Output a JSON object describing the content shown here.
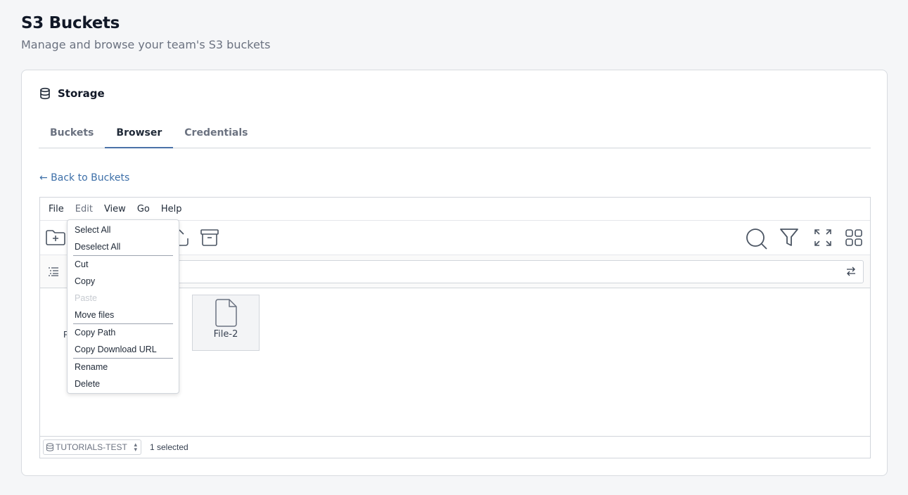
{
  "header": {
    "title": "S3 Buckets",
    "subtitle": "Manage and browse your team's S3 buckets"
  },
  "card": {
    "title": "Storage",
    "icon": "database-icon"
  },
  "tabs": [
    {
      "label": "Buckets",
      "active": false
    },
    {
      "label": "Browser",
      "active": true
    },
    {
      "label": "Credentials",
      "active": false
    }
  ],
  "back_link": "← Back to Buckets",
  "menubar": {
    "file": "File",
    "edit": "Edit",
    "view": "View",
    "go": "Go",
    "help": "Help"
  },
  "toolbar": {
    "icons": [
      "new-folder-icon",
      "upload-icon",
      "archive-icon",
      "search-icon",
      "filter-icon",
      "fullscreen-icon",
      "grid-view-icon"
    ]
  },
  "files": [
    {
      "name": "File-2",
      "icon": "file-icon"
    }
  ],
  "partial_file_label": "F",
  "edit_menu": {
    "select_all": "Select All",
    "deselect_all": "Deselect All",
    "cut": "Cut",
    "copy": "Copy",
    "paste": "Paste",
    "move_files": "Move files",
    "copy_path": "Copy Path",
    "copy_download_url": "Copy Download URL",
    "rename": "Rename",
    "delete": "Delete"
  },
  "statusbar": {
    "bucket": "TUTORIALS-TEST",
    "selected": "1 selected"
  },
  "colors": {
    "accent": "#4a72a8",
    "link": "#3d6fa8",
    "background": "#f5f6f8"
  }
}
